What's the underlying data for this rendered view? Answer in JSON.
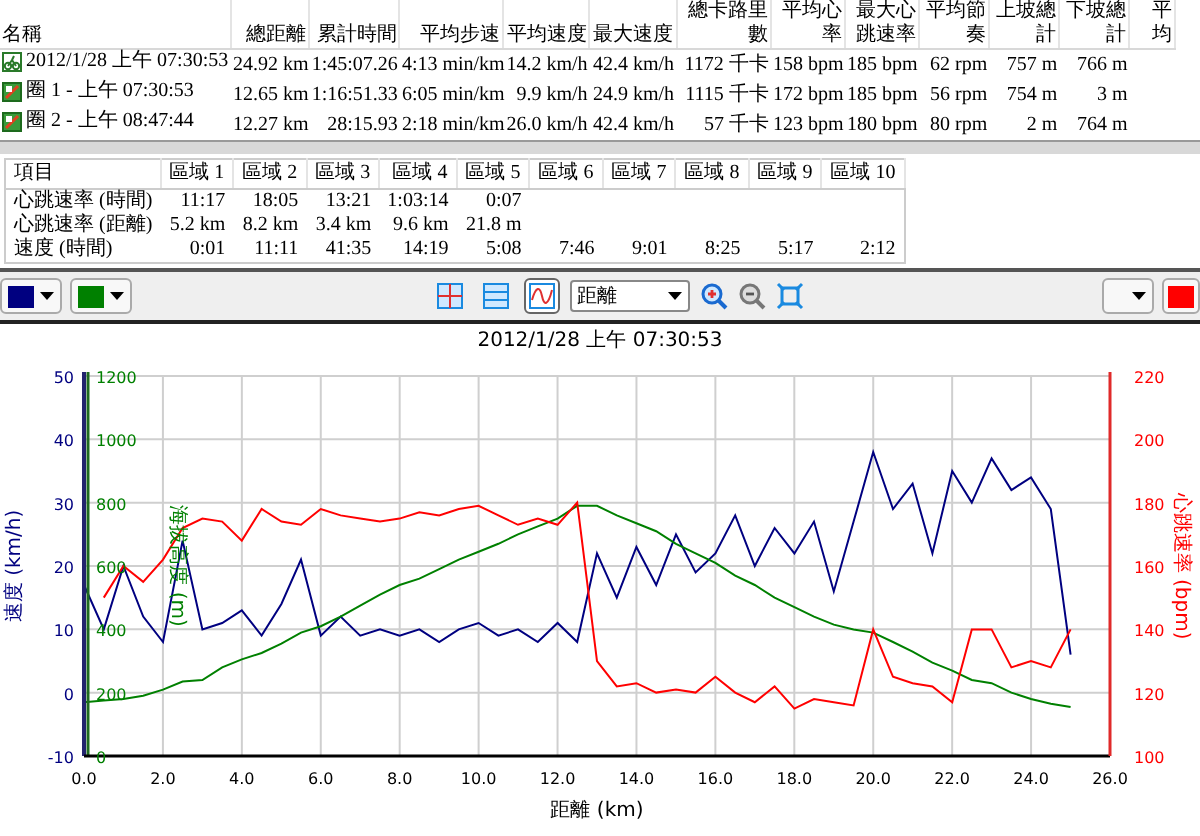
{
  "summary_table": {
    "columns": [
      "名稱",
      "總距離",
      "累計時間",
      "平均步速",
      "平均速度",
      "最大速度",
      "總卡路里數",
      "平均心率",
      "最大心跳速率",
      "平均節奏",
      "上坡總計",
      "下坡總計",
      "平均"
    ],
    "rows": [
      {
        "kind": "activity",
        "cells": [
          "2012/1/28 上午 07:30:53",
          "24.92 km",
          "1:45:07.26",
          "4:13 min/km",
          "14.2 km/h",
          "42.4 km/h",
          "1172 千卡",
          "158 bpm",
          "185 bpm",
          "62 rpm",
          "757 m",
          "766 m"
        ]
      },
      {
        "kind": "lap",
        "cells": [
          "圈 1 - 上午 07:30:53",
          "12.65 km",
          "1:16:51.33",
          "6:05 min/km",
          "9.9 km/h",
          "24.9 km/h",
          "1115 千卡",
          "172 bpm",
          "185 bpm",
          "56 rpm",
          "754 m",
          "3 m"
        ]
      },
      {
        "kind": "lap",
        "cells": [
          "圈 2 - 上午 08:47:44",
          "12.27 km",
          "28:15.93",
          "2:18 min/km",
          "26.0 km/h",
          "42.4 km/h",
          "57 千卡",
          "123 bpm",
          "180 bpm",
          "80 rpm",
          "2 m",
          "764 m"
        ]
      }
    ]
  },
  "zone_table": {
    "columns": [
      "項目",
      "區域 1",
      "區域 2",
      "區域 3",
      "區域 4",
      "區域 5",
      "區域 6",
      "區域 7",
      "區域 8",
      "區域 9",
      "區域 10"
    ],
    "rows": [
      [
        "心跳速率 (時間)",
        "11:17",
        "18:05",
        "13:21",
        "1:03:14",
        "0:07",
        "",
        "",
        "",
        "",
        ""
      ],
      [
        "心跳速率 (距離)",
        "5.2 km",
        "8.2 km",
        "3.4 km",
        "9.6 km",
        "21.8 m",
        "",
        "",
        "",
        "",
        ""
      ],
      [
        "速度 (時間)",
        "0:01",
        "11:11",
        "41:35",
        "14:19",
        "5:08",
        "7:46",
        "9:01",
        "8:25",
        "5:17",
        "2:12"
      ]
    ]
  },
  "toolbar": {
    "left_pickers": [
      {
        "color": "#000080"
      },
      {
        "color": "#008000"
      }
    ],
    "view_buttons": [
      {
        "selected": false
      },
      {
        "selected": false
      },
      {
        "selected": true
      }
    ],
    "axis_select": "距離",
    "right_pickers": [
      {
        "color": "#ff0000"
      }
    ]
  },
  "chart": {
    "title": "2012/1/28 上午 07:30:53",
    "chart_data": {
      "type": "line",
      "grid": true,
      "xlabel": "距離 (km)",
      "ylabel": "速度 (km/h)",
      "y2label": "海拔高度 (m)",
      "y3label": "心跳速率 (bpm)",
      "xlim": [
        0,
        26
      ],
      "ylim": [
        -10,
        50
      ],
      "y2lim": [
        0,
        1200
      ],
      "y3lim": [
        100,
        220
      ],
      "y2ticks": [
        1200,
        1000,
        800,
        600,
        400,
        200,
        0
      ],
      "y3ticks": [
        220,
        200,
        180,
        160,
        140,
        120,
        100
      ],
      "xticks": [
        {
          "value": 0,
          "label": "0.0"
        },
        {
          "value": 2,
          "label": "2.0"
        },
        {
          "value": 4,
          "label": "4.0"
        },
        {
          "value": 6,
          "label": "6.0"
        },
        {
          "value": 8,
          "label": "8.0"
        },
        {
          "value": 10,
          "label": "10.0"
        },
        {
          "value": 12,
          "label": "12.0"
        },
        {
          "value": 14,
          "label": "14.0"
        },
        {
          "value": 16,
          "label": "16.0"
        },
        {
          "value": 18,
          "label": "18.0"
        },
        {
          "value": 20,
          "label": "20.0"
        },
        {
          "value": 22,
          "label": "22.0"
        },
        {
          "value": 24,
          "label": "24.0"
        },
        {
          "value": 26,
          "label": "26.0"
        }
      ],
      "yticks": [
        50,
        40,
        30,
        20,
        10,
        0,
        -10
      ],
      "x": [
        0,
        0.5,
        1,
        1.5,
        2,
        2.5,
        3,
        3.5,
        4,
        4.5,
        5,
        5.5,
        6,
        6.5,
        7,
        7.5,
        8,
        8.5,
        9,
        9.5,
        10,
        10.5,
        11,
        11.5,
        12,
        12.5,
        13,
        13.5,
        14,
        14.5,
        15,
        15.5,
        16,
        16.5,
        17,
        17.5,
        18,
        18.5,
        19,
        19.5,
        20,
        20.5,
        21,
        21.5,
        22,
        22.5,
        23,
        23.5,
        24,
        24.5,
        25
      ],
      "series": [
        {
          "color": "#000080",
          "values": [
            17,
            10,
            20,
            12,
            8,
            24,
            10,
            11,
            13,
            9,
            14,
            21,
            9,
            12,
            9,
            10,
            9,
            10,
            8,
            10,
            11,
            9,
            10,
            8,
            11,
            8,
            22,
            15,
            23,
            17,
            25,
            19,
            22,
            28,
            20,
            26,
            22,
            27,
            16,
            27,
            38,
            29,
            33,
            22,
            35,
            30,
            37,
            32,
            34,
            29,
            6
          ]
        },
        {
          "axis": "y2",
          "color": "#008000",
          "values": [
            170,
            175,
            180,
            190,
            210,
            235,
            240,
            280,
            305,
            325,
            355,
            390,
            410,
            440,
            475,
            510,
            540,
            560,
            590,
            620,
            645,
            670,
            700,
            725,
            750,
            790,
            790,
            760,
            735,
            710,
            670,
            640,
            610,
            570,
            540,
            500,
            470,
            440,
            415,
            400,
            390,
            360,
            330,
            295,
            270,
            240,
            230,
            200,
            180,
            165,
            155
          ]
        },
        {
          "axis": "y3",
          "color": "#ff0000",
          "values": [
            null,
            150,
            160,
            155,
            162,
            172,
            175,
            174,
            168,
            178,
            174,
            173,
            178,
            176,
            175,
            174,
            175,
            177,
            176,
            178,
            179,
            176,
            173,
            175,
            173,
            180,
            130,
            122,
            123,
            120,
            121,
            120,
            125,
            120,
            117,
            122,
            115,
            118,
            117,
            116,
            140,
            125,
            123,
            122,
            117,
            140,
            140,
            128,
            130,
            128,
            140
          ]
        }
      ]
    }
  }
}
